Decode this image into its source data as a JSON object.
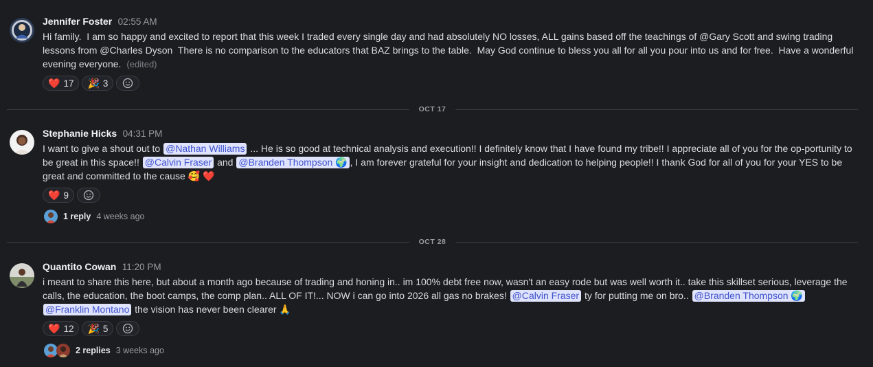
{
  "messages": [
    {
      "author": "Jennifer Foster",
      "time": "02:55 AM",
      "text": "Hi family.  I am so happy and excited to report that this week I traded every single day and had absolutely NO losses, ALL gains based off the teachings of @Gary Scott and swing trading lessons from @Charles Dyson  There is no comparison to the educators that BAZ brings to the table.  May God continue to bless you all for all you pour into us and for free.  Have a wonderful evening everyone.",
      "edited": "(edited)",
      "reactions": [
        {
          "icon": "heart",
          "emoji": "❤️",
          "count": "17"
        },
        {
          "icon": "party-popper",
          "emoji": "🎉",
          "count": "3"
        }
      ]
    },
    {
      "author": "Stephanie Hicks",
      "time": "04:31 PM",
      "segments": [
        "I want to give a shout out to ",
        "@Nathan Williams",
        " ... He is so good at technical analysis and execution!! I definitely know that I have found my tribe!! I appreciate all of you for the op-portunity to be great in this space!! ",
        "@Calvin Fraser",
        " and ",
        "@Branden Thompson 🌍",
        ", I am forever grateful for your insight and dedication to helping people!! I thank God for all of you for your YES to be great and committed to the cause 🥰 ❤️"
      ],
      "reactions": [
        {
          "icon": "heart",
          "emoji": "❤️",
          "count": "9"
        }
      ],
      "reply_count": "1 reply",
      "reply_ago": "4 weeks ago"
    },
    {
      "author": "Quantito Cowan",
      "time": "11:20 PM",
      "segments": [
        "i meant to share this here, but about a month ago because of trading and honing in.. im 100% debt free now, wasn't an easy rode but was well worth it.. take this skillset serious, leverage the calls, the education, the boot camps, the comp plan.. ALL OF IT!... NOW i can go into 2026 all gas no brakes! ",
        "@Calvin Fraser",
        " ty for putting me on bro.. ",
        "@Branden Thompson 🌍",
        "  ",
        "@Franklin Montano",
        " the vision has never been clearer 🙏"
      ],
      "reactions": [
        {
          "icon": "heart",
          "emoji": "❤️",
          "count": "12"
        },
        {
          "icon": "party-popper",
          "emoji": "🎉",
          "count": "5"
        }
      ],
      "reply_count": "2 replies",
      "reply_ago": "3 weeks ago"
    }
  ],
  "dividers": [
    "OCT 17",
    "OCT 28"
  ],
  "icons": {
    "add_reaction": "smiley-add-icon"
  },
  "colors": {
    "background": "#1c1d21",
    "mention_bg": "#dfe3fb",
    "mention_text": "#3f52cf"
  }
}
